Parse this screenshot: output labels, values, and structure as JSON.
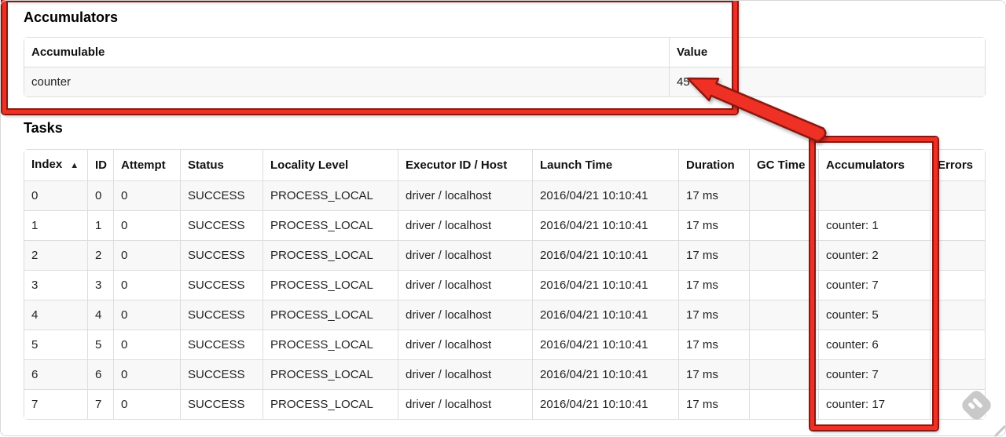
{
  "accumulators": {
    "heading": "Accumulators",
    "columns": [
      "Accumulable",
      "Value"
    ],
    "rows": [
      [
        "counter",
        "45"
      ]
    ]
  },
  "tasks": {
    "heading": "Tasks",
    "columns": [
      "Index",
      "ID",
      "Attempt",
      "Status",
      "Locality Level",
      "Executor ID / Host",
      "Launch Time",
      "Duration",
      "GC Time",
      "Accumulators",
      "Errors"
    ],
    "sort": {
      "column": "Index",
      "direction": "ascending",
      "indicator": "▲"
    },
    "rows": [
      [
        "0",
        "0",
        "0",
        "SUCCESS",
        "PROCESS_LOCAL",
        "driver / localhost",
        "2016/04/21 10:10:41",
        "17 ms",
        "",
        "",
        ""
      ],
      [
        "1",
        "1",
        "0",
        "SUCCESS",
        "PROCESS_LOCAL",
        "driver / localhost",
        "2016/04/21 10:10:41",
        "17 ms",
        "",
        "counter: 1",
        ""
      ],
      [
        "2",
        "2",
        "0",
        "SUCCESS",
        "PROCESS_LOCAL",
        "driver / localhost",
        "2016/04/21 10:10:41",
        "17 ms",
        "",
        "counter: 2",
        ""
      ],
      [
        "3",
        "3",
        "0",
        "SUCCESS",
        "PROCESS_LOCAL",
        "driver / localhost",
        "2016/04/21 10:10:41",
        "17 ms",
        "",
        "counter: 7",
        ""
      ],
      [
        "4",
        "4",
        "0",
        "SUCCESS",
        "PROCESS_LOCAL",
        "driver / localhost",
        "2016/04/21 10:10:41",
        "17 ms",
        "",
        "counter: 5",
        ""
      ],
      [
        "5",
        "5",
        "0",
        "SUCCESS",
        "PROCESS_LOCAL",
        "driver / localhost",
        "2016/04/21 10:10:41",
        "17 ms",
        "",
        "counter: 6",
        ""
      ],
      [
        "6",
        "6",
        "0",
        "SUCCESS",
        "PROCESS_LOCAL",
        "driver / localhost",
        "2016/04/21 10:10:41",
        "17 ms",
        "",
        "counter: 7",
        ""
      ],
      [
        "7",
        "7",
        "0",
        "SUCCESS",
        "PROCESS_LOCAL",
        "driver / localhost",
        "2016/04/21 10:10:41",
        "17 ms",
        "",
        "counter: 17",
        ""
      ]
    ]
  },
  "annotations": {
    "color": "#ee3124",
    "outline_color": "#8c1710"
  }
}
